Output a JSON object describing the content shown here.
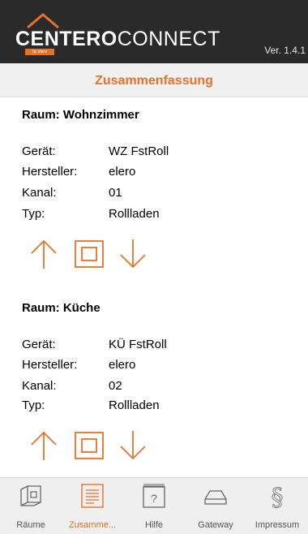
{
  "header": {
    "logo_bold": "CENTERO",
    "logo_light": "CONNECT",
    "logo_sub": "by elero",
    "version": "Ver. 1.4.1"
  },
  "title": "Zusammenfassung",
  "rooms": [
    {
      "title": "Raum: Wohnzimmer",
      "fields": [
        {
          "key": "Gerät:",
          "value": "WZ FstRoll"
        },
        {
          "key": "Hersteller:",
          "value": "elero"
        },
        {
          "key": "Kanal:",
          "value": "01"
        },
        {
          "key": "Typ:",
          "value": "Rollladen"
        }
      ]
    },
    {
      "title": "Raum: Küche",
      "fields": [
        {
          "key": "Gerät:",
          "value": "KÜ FstRoll"
        },
        {
          "key": "Hersteller:",
          "value": "elero"
        },
        {
          "key": "Kanal:",
          "value": "02"
        },
        {
          "key": "Typ:",
          "value": "Rollladen"
        }
      ]
    }
  ],
  "tabs": [
    {
      "label": "Räume",
      "icon": "rooms-icon",
      "active": false
    },
    {
      "label": "Zusamme...",
      "icon": "summary-icon",
      "active": true
    },
    {
      "label": "Hilfe",
      "icon": "help-icon",
      "active": false
    },
    {
      "label": "Gateway",
      "icon": "gateway-icon",
      "active": false
    },
    {
      "label": "Impressum",
      "icon": "paragraph-icon",
      "active": false
    }
  ],
  "colors": {
    "accent": "#e8722a",
    "header": "#2a2a2a"
  }
}
